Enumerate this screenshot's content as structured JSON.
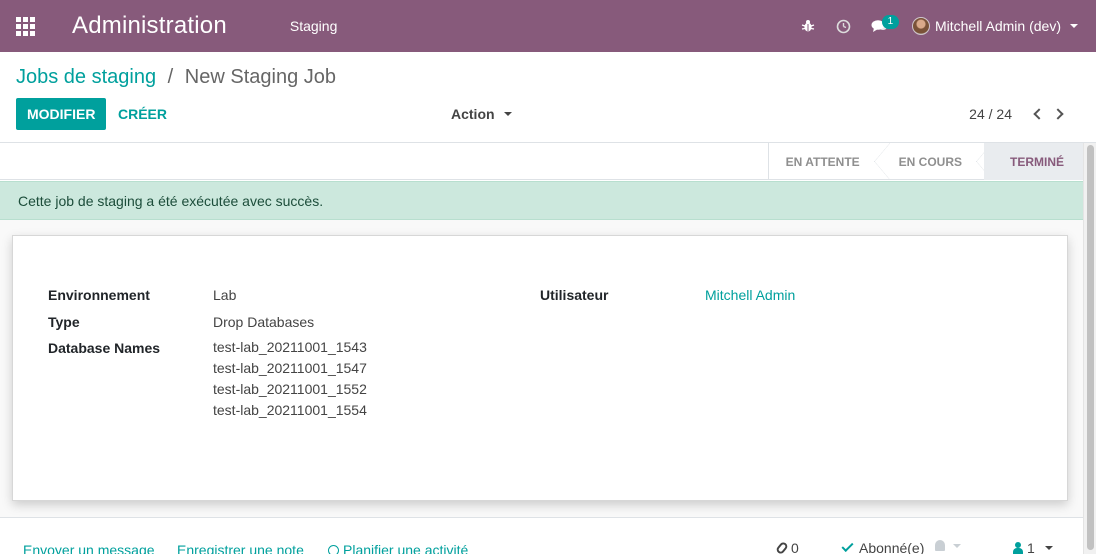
{
  "navbar": {
    "app_title": "Administration",
    "menu_item": "Staging",
    "chat_badge": "1",
    "user_name": "Mitchell Admin (dev)",
    "icons": [
      "apps-grid-icon",
      "bug-icon",
      "clock-icon",
      "chat-icon",
      "avatar"
    ]
  },
  "breadcrumb": {
    "parent": "Jobs de staging",
    "separator": "/",
    "current": "New Staging Job"
  },
  "buttons": {
    "edit": "MODIFIER",
    "create": "CRÉER",
    "action": "Action"
  },
  "pager": {
    "value": "24 / 24"
  },
  "stages": [
    {
      "label": "EN ATTENTE",
      "active": false
    },
    {
      "label": "EN COURS",
      "active": false
    },
    {
      "label": "TERMINÉ",
      "active": true
    }
  ],
  "alert": {
    "message": "Cette job de staging a été exécutée avec succès."
  },
  "form": {
    "environment_label": "Environnement",
    "environment_value": "Lab",
    "type_label": "Type",
    "type_value": "Drop Databases",
    "db_label": "Database Names",
    "db_values": [
      "test-lab_20211001_1543",
      "test-lab_20211001_1547",
      "test-lab_20211001_1552",
      "test-lab_20211001_1554"
    ],
    "user_label": "Utilisateur",
    "user_value": "Mitchell Admin"
  },
  "chatter": {
    "send_message": "Envoyer un message",
    "log_note": "Enregistrer une note",
    "schedule_activity": "Planifier une activité",
    "attachments_count": "0",
    "follow_label": "Abonné(e)",
    "followers_count": "1"
  },
  "colors": {
    "brand": "#875a7b",
    "accent": "#00a09d",
    "alert_bg": "#cce8dd"
  }
}
